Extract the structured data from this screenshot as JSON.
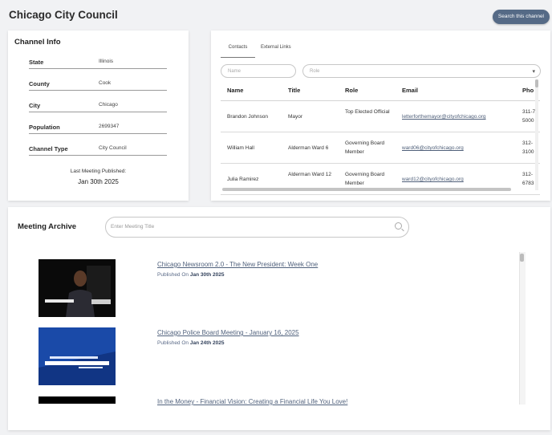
{
  "header": {
    "title": "Chicago City Council",
    "search_button": "Search this channel"
  },
  "channel_info": {
    "title": "Channel Info",
    "rows": [
      {
        "label": "State",
        "value": "Illinois"
      },
      {
        "label": "County",
        "value": "Cook"
      },
      {
        "label": "City",
        "value": "Chicago"
      },
      {
        "label": "Population",
        "value": "2699347"
      },
      {
        "label": "Channel Type",
        "value": "City Council"
      }
    ],
    "last_meeting_label": "Last Meeting Published:",
    "last_meeting_date": "Jan 30th 2025"
  },
  "contacts": {
    "tabs": [
      "Contacts",
      "External Links"
    ],
    "active_tab": "Contacts",
    "name_placeholder": "Name",
    "role_placeholder": "Role",
    "columns": [
      "Name",
      "Title",
      "Role",
      "Email",
      "Pho"
    ],
    "rows": [
      {
        "name": "Brandon Johnson",
        "title": "Mayor",
        "role": "Top Elected Official",
        "email": "letterforthemayor@cityofchicago.org",
        "phone": "311-7 5000"
      },
      {
        "name": "William Hall",
        "title": "Alderman Ward 6",
        "role": "Governing Board Member",
        "email": "ward06@cityofchicago.org",
        "phone": "312- 3100"
      },
      {
        "name": "Julia Ramirez",
        "title": "Alderman Ward 12",
        "role": "Governing Board Member",
        "email": "ward12@cityofchicago.org",
        "phone": "312- 6783"
      }
    ]
  },
  "archive": {
    "title": "Meeting Archive",
    "search_placeholder": "Enter Meeting Title",
    "published_prefix": "Published On",
    "meetings": [
      {
        "title": "Chicago Newsroom 2.0 - The New President: Week One",
        "date": "Jan 30th 2025"
      },
      {
        "title": "Chicago Police Board Meeting - January 16, 2025",
        "date": "Jan 24th 2025"
      },
      {
        "title": "In the Money - Financial Vision: Creating a Financial Life You Love!",
        "date": ""
      }
    ]
  }
}
